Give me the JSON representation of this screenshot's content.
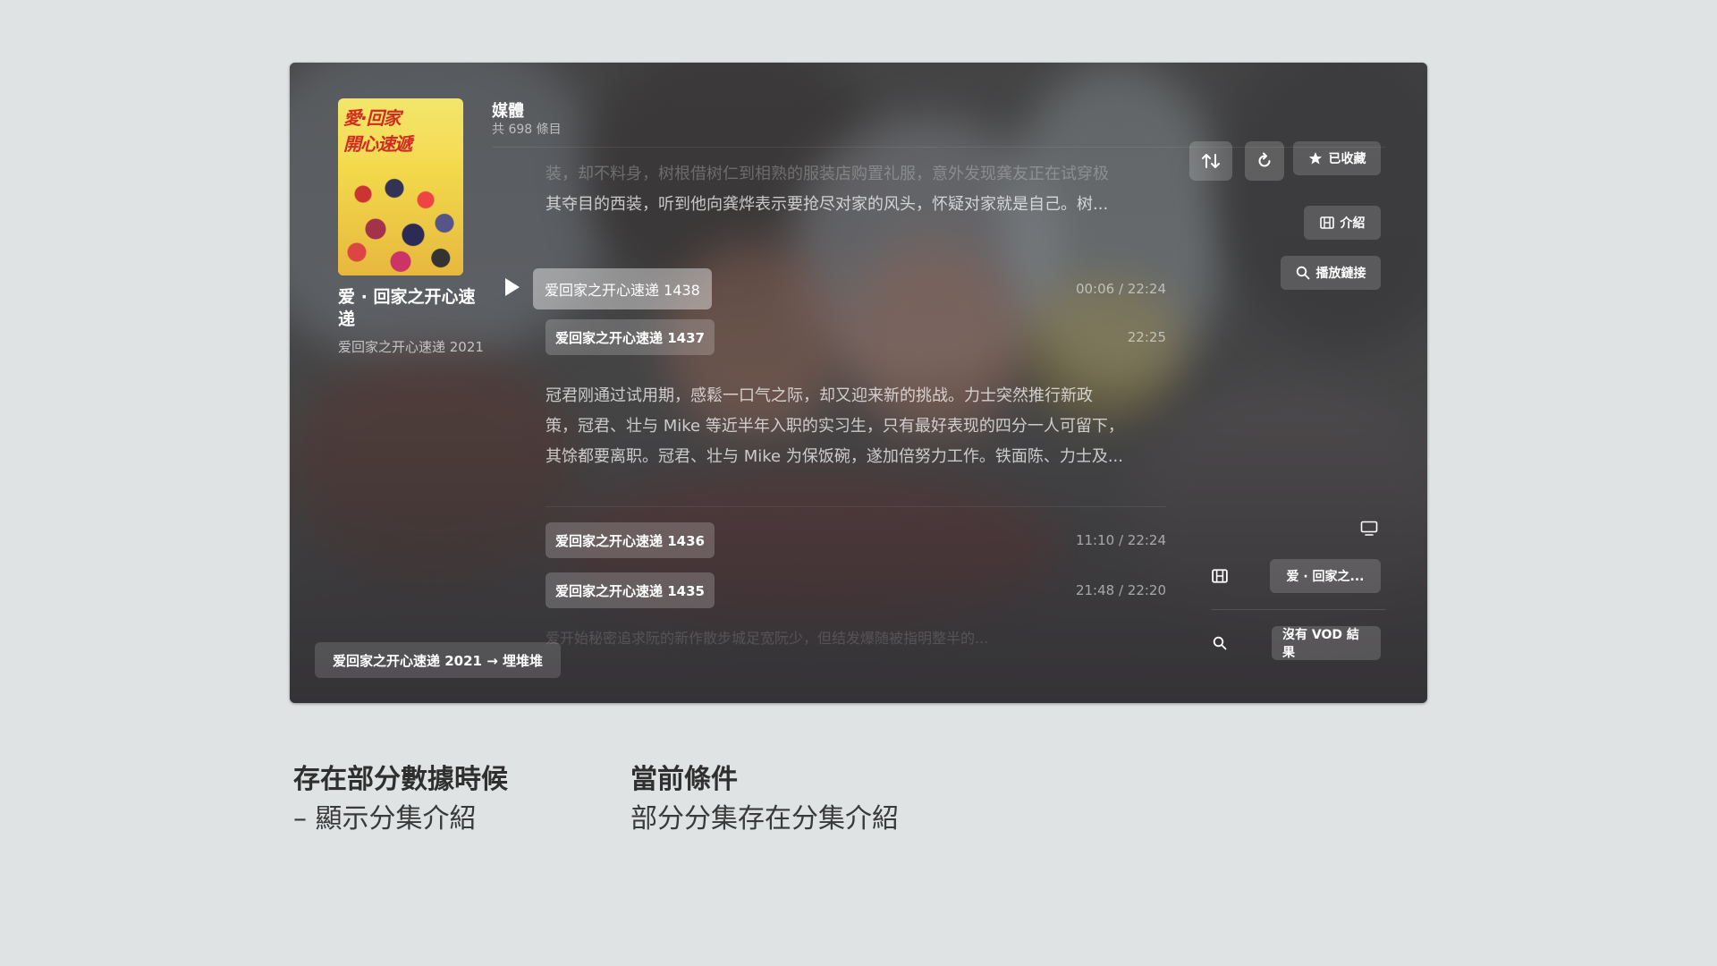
{
  "show": {
    "title": "爱 · 回家之开心速递",
    "subtitle": "爱回家之开心速递 2021",
    "poster_label": "愛·回家 開心速遞"
  },
  "media": {
    "title": "媒體",
    "count": "共 698 條目"
  },
  "toolbar": {
    "sort_icon": "sort-arrows-icon",
    "refresh_icon": "refresh-icon",
    "favorite_label": "已收藏",
    "intro_label": "介紹",
    "play_link_label": "播放鏈接"
  },
  "episodes": [
    {
      "title": "爱回家之开心速递 1438",
      "time": "00:06 ∕ 22:24",
      "active": true
    },
    {
      "title": "爱回家之开心速递 1437",
      "time": "22:25",
      "active": false
    },
    {
      "title": "爱回家之开心速递 1436",
      "time": "11:10 ∕ 22:24",
      "active": false
    },
    {
      "title": "爱回家之开心速递 1435",
      "time": "21:48 ∕ 22:20",
      "active": false
    }
  ],
  "descriptions": {
    "top_line1": "装，却不料身，树根借树仁到相熟的服装店购置礼服，意外发现龚友正在试穿极",
    "top_line2": "其夺目的西装，听到他向龚烨表示要抢尽对家的风头，怀疑对家就是自己。树...",
    "ep1437": [
      "冠君刚通过试用期，感鬆一口气之际，却又迎来新的挑战。力士突然推行新政",
      "策，冠君、壮与 Mike 等近半年入职的实习生，只有最好表现的四分一人可留下，",
      "其馀都要离职。冠君、壮与 Mike 为保饭碗，遂加倍努力工作。铁面陈、力士及..."
    ],
    "bottom_fade": "爱开始秘密追求阮的新作散步城足宽阮少，但结发爆随被指明整半的..."
  },
  "side_panel": {
    "tv_icon": "tv-icon",
    "film_icon": "film-icon",
    "match_label": "爱 · 回家之...",
    "search_icon": "search-icon",
    "vod_label": "沒有 VOD 結果"
  },
  "bottom_bar": {
    "path_label": "爱回家之开心速递 2021 → 埋堆堆"
  },
  "captions": {
    "left_title": "存在部分數據時候",
    "left_text": "– 顯示分集介紹",
    "right_title": "當前條件",
    "right_text": "部分分集存在分集介紹"
  }
}
